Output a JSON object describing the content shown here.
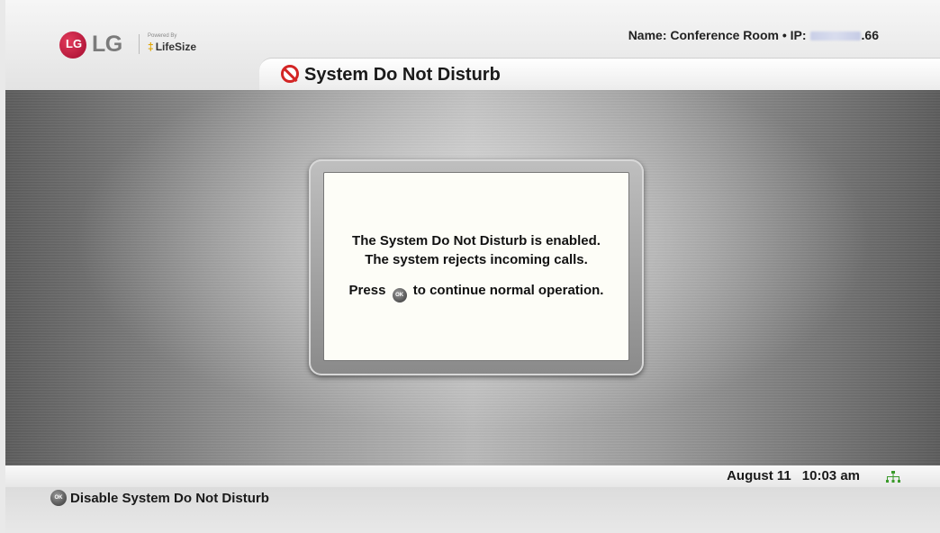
{
  "header": {
    "brand": "LG",
    "brand_badge": "LG",
    "powered_by": "Powered By",
    "partner": "LifeSize",
    "name_label": "Name:",
    "name_value": "Conference Room",
    "separator": "•",
    "ip_label": "IP:",
    "ip_suffix": ".66"
  },
  "title": {
    "text": "System Do Not Disturb",
    "icon": "do-not-disturb-icon"
  },
  "dialog": {
    "line1": "The System Do Not Disturb is enabled.",
    "line2": "The system rejects incoming calls.",
    "press_prefix": "Press",
    "ok_label": "OK",
    "press_suffix": "to continue normal operation."
  },
  "status": {
    "date": "August 11",
    "time": "10:03 am",
    "network_icon": "network-icon"
  },
  "footer": {
    "ok_label": "OK",
    "action": "Disable System Do Not Disturb"
  },
  "colors": {
    "accent_red": "#d32525",
    "lg_red": "#a30b2f",
    "dialog_bg": "#fdfdf7"
  }
}
